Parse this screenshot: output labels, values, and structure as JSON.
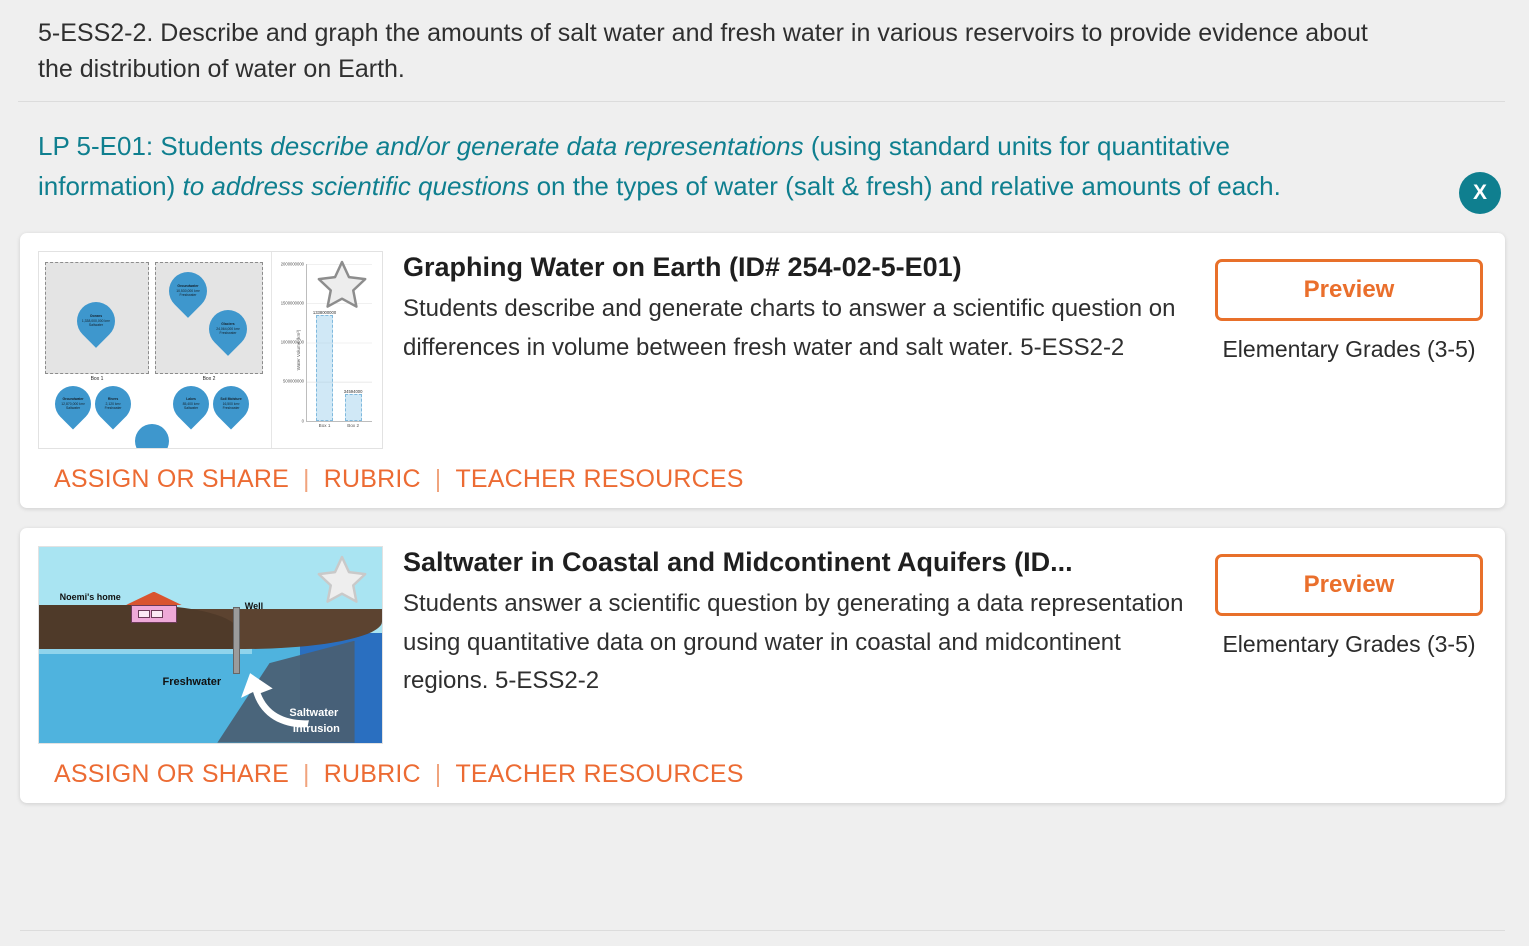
{
  "standard": {
    "text": "5-ESS2-2. Describe and graph the amounts of salt water and fresh water in various reservoirs to provide evidence about the distribution of water on Earth."
  },
  "learning_performance": {
    "prefix": "LP 5-E01: Students ",
    "italic_1": "describe and/or generate data representations",
    "middle": " (using standard units for quantitative information) ",
    "italic_2": "to address scientific questions",
    "suffix": " on the types of water (salt & fresh) and relative amounts of each.",
    "close_label": "X"
  },
  "colors": {
    "teal": "#0f7f8f",
    "orange": "#ec6b33",
    "orange_button_border": "#e8702a",
    "page_background": "#efefef",
    "card_background": "#ffffff"
  },
  "cards": [
    {
      "title": "Graphing Water on Earth (ID# 254-02-5-E01)",
      "description": "Students describe and generate charts to answer a scientific question on differences in volume between fresh water and salt water. 5-ESS2-2",
      "preview_label": "Preview",
      "grade_label": "Elementary Grades (3-5)",
      "links": [
        "ASSIGN OR SHARE",
        "RUBRIC",
        "TEACHER RESOURCES"
      ],
      "link_separator": "|",
      "favorite_icon": "star-icon",
      "thumbnail": {
        "type": "water-drops-and-bar-chart",
        "box_labels": [
          "Box 1",
          "Box 2"
        ],
        "drops": [
          {
            "name": "Oceans",
            "volume": "1,338,000,000 km³",
            "kind": "Saltwater",
            "box": "Box 1"
          },
          {
            "name": "Groundwater",
            "volume": "10,530,000 km³",
            "kind": "Freshwater",
            "box": "Box 2"
          },
          {
            "name": "Glaciers",
            "volume": "24,064,000 km³",
            "kind": "Freshwater",
            "box": "Box 2"
          },
          {
            "name": "Groundwater",
            "volume": "12,870,000 km³",
            "kind": "Saltwater",
            "box": "loose"
          },
          {
            "name": "Rivers",
            "volume": "2,120 km³",
            "kind": "Freshwater",
            "box": "loose"
          },
          {
            "name": "Lakes",
            "volume": "85,400 km³",
            "kind": "Saltwater",
            "box": "loose"
          },
          {
            "name": "Soil Moisture",
            "volume": "16,500 km³",
            "kind": "Freshwater",
            "box": "loose"
          }
        ],
        "chart": {
          "type": "bar",
          "categories": [
            "Box 1",
            "Box 2"
          ],
          "values": [
            1338000000,
            34594000
          ],
          "value_labels": [
            "1338000000",
            "34594000"
          ],
          "ylabel": "Water Volume (km³)",
          "ylim": [
            0,
            2000000000
          ],
          "yticks": [
            0,
            500000000,
            1000000000,
            1500000000,
            2000000000
          ],
          "ytick_labels": [
            "0",
            "500000000",
            "1000000000",
            "1500000000",
            "2000000000"
          ]
        }
      }
    },
    {
      "title": "Saltwater in Coastal and Midcontinent Aquifers (ID...",
      "description": "Students answer a scientific question by generating a data representation using quantitative data on ground water in coastal and midcontinent regions. 5-ESS2-2",
      "preview_label": "Preview",
      "grade_label": "Elementary Grades (3-5)",
      "links": [
        "ASSIGN OR SHARE",
        "RUBRIC",
        "TEACHER RESOURCES"
      ],
      "link_separator": "|",
      "favorite_icon": "star-icon",
      "thumbnail": {
        "type": "aquifer-cross-section",
        "labels": {
          "home": "Noemi's home",
          "well": "Well",
          "freshwater": "Freshwater",
          "intrusion_line1": "Saltwater",
          "intrusion_line2": "Intrusion"
        }
      }
    }
  ]
}
